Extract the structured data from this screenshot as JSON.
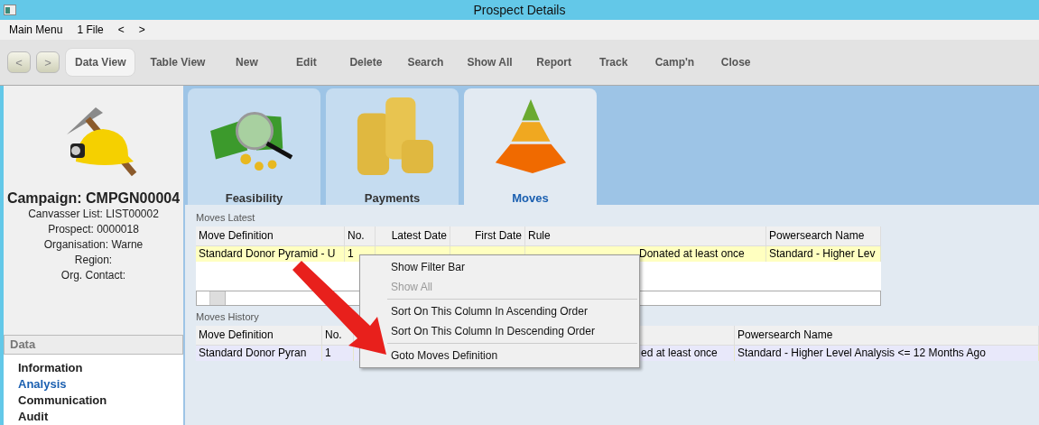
{
  "window": {
    "title": "Prospect Details"
  },
  "menu_bar": {
    "items": [
      "Main Menu",
      "1 File",
      "<",
      ">"
    ]
  },
  "toolbar": {
    "nav": [
      "<",
      ">"
    ],
    "buttons": [
      {
        "label": "Data View",
        "selected": true
      },
      {
        "label": "Table View",
        "selected": false
      },
      {
        "label": "New",
        "selected": false
      },
      {
        "label": "Edit",
        "selected": false
      },
      {
        "label": "Delete",
        "selected": false
      },
      {
        "label": "Search",
        "selected": false
      },
      {
        "label": "Show All",
        "selected": false
      },
      {
        "label": "Report",
        "selected": false
      },
      {
        "label": "Track",
        "selected": false
      },
      {
        "label": "Camp'n",
        "selected": false
      },
      {
        "label": "Close",
        "selected": false
      }
    ]
  },
  "summary": {
    "heading": "Campaign: CMPGN00004",
    "lines": [
      "Canvasser List: LIST00002",
      "Prospect: 0000018",
      "Organisation: Warne",
      "Region:",
      "Org. Contact:"
    ]
  },
  "sidebar": {
    "title": "Data",
    "items": [
      {
        "label": "Information",
        "selected": false
      },
      {
        "label": "Analysis",
        "selected": true
      },
      {
        "label": "Communication",
        "selected": false
      },
      {
        "label": "Audit",
        "selected": false
      }
    ]
  },
  "tabs": [
    {
      "label": "Feasibility",
      "kind": "feasibility",
      "selected": false
    },
    {
      "label": "Payments",
      "kind": "payments",
      "selected": false
    },
    {
      "label": "Moves",
      "kind": "moves",
      "selected": true
    }
  ],
  "moves_latest": {
    "title": "Moves Latest",
    "columns": [
      "Move Definition",
      "No.",
      "Latest Date",
      "First Date",
      "Rule",
      "Powersearch Name"
    ],
    "rows": [
      {
        "cells": [
          "Standard Donor Pyramid - U",
          "1",
          "",
          "",
          "Donated at least once",
          "Standard - Higher Lev"
        ],
        "selected": true
      }
    ]
  },
  "moves_history": {
    "title": "Moves History",
    "columns": [
      "Move Definition",
      "No.",
      "",
      "",
      "",
      "Powersearch Name"
    ],
    "rows": [
      {
        "cells": [
          "Standard Donor Pyran",
          "1",
          "",
          "",
          "ed at least once",
          "Standard - Higher Level Analysis <= 12 Months Ago"
        ],
        "selected": true
      }
    ]
  },
  "context_menu": {
    "items": [
      {
        "label": "Show Filter Bar",
        "disabled": false,
        "kind": "item"
      },
      {
        "label": "Show All",
        "disabled": true,
        "kind": "item"
      },
      {
        "kind": "separator"
      },
      {
        "label": "Sort On This Column In Ascending Order",
        "disabled": false,
        "kind": "item"
      },
      {
        "label": "Sort On This Column In Descending Order",
        "disabled": false,
        "kind": "item"
      },
      {
        "kind": "separator"
      },
      {
        "label": "Goto Moves Definition",
        "disabled": false,
        "kind": "item"
      }
    ]
  }
}
